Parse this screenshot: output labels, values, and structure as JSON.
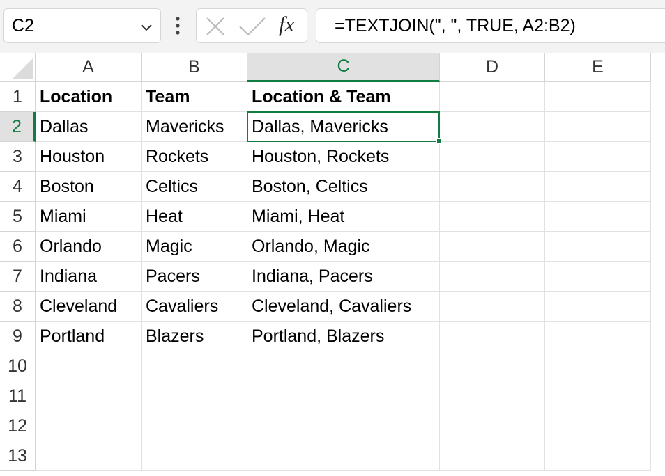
{
  "name_box": {
    "value": "C2"
  },
  "formula_bar": {
    "formula": "=TEXTJOIN(\", \", TRUE, A2:B2)",
    "fx_label": "fx"
  },
  "columns": [
    "A",
    "B",
    "C",
    "D",
    "E"
  ],
  "selected_column": "C",
  "rows": [
    "1",
    "2",
    "3",
    "4",
    "5",
    "6",
    "7",
    "8",
    "9",
    "10",
    "11",
    "12",
    "13"
  ],
  "selected_row": "2",
  "cells": [
    [
      "Location",
      "Team",
      "Location & Team",
      "",
      ""
    ],
    [
      "Dallas",
      "Mavericks",
      "Dallas, Mavericks",
      "",
      ""
    ],
    [
      "Houston",
      "Rockets",
      "Houston, Rockets",
      "",
      ""
    ],
    [
      "Boston",
      "Celtics",
      "Boston, Celtics",
      "",
      ""
    ],
    [
      "Miami",
      "Heat",
      "Miami, Heat",
      "",
      ""
    ],
    [
      "Orlando",
      "Magic",
      "Orlando, Magic",
      "",
      ""
    ],
    [
      "Indiana",
      "Pacers",
      "Indiana, Pacers",
      "",
      ""
    ],
    [
      "Cleveland",
      "Cavaliers",
      "Cleveland, Cavaliers",
      "",
      ""
    ],
    [
      "Portland",
      "Blazers",
      "Portland, Blazers",
      "",
      ""
    ],
    [
      "",
      "",
      "",
      "",
      ""
    ],
    [
      "",
      "",
      "",
      "",
      ""
    ],
    [
      "",
      "",
      "",
      "",
      ""
    ],
    [
      "",
      "",
      "",
      "",
      ""
    ]
  ],
  "active_cell": "C2",
  "colors": {
    "accent": "#107c41",
    "header_selected_bg": "#e1e1e1"
  }
}
